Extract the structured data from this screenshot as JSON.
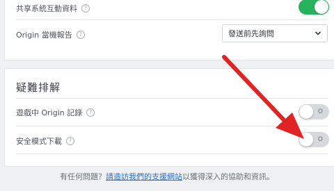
{
  "card1": {
    "share_label": "共享系統互動資料",
    "share_toggle_state": "",
    "report_label": "Origin 當機報告",
    "report_select_value": "發送前先詢問"
  },
  "troubleshoot": {
    "title": "疑難排解",
    "ingame_label": "遊戲中 Origin 記錄",
    "ingame_toggle_state": "O",
    "safemode_label": "安全模式下載",
    "safemode_toggle_state": "O"
  },
  "footer": {
    "prefix": "有任何問題？",
    "link": "請造訪我們的支援網站",
    "suffix": "以獲得深入的協助和資訊。"
  },
  "help_glyph": "?",
  "colors": {
    "toggle_on": "#27b35d",
    "toggle_off": "#d5d8dc",
    "link": "#2a6fd1",
    "annotation_arrow": "#e02424"
  }
}
